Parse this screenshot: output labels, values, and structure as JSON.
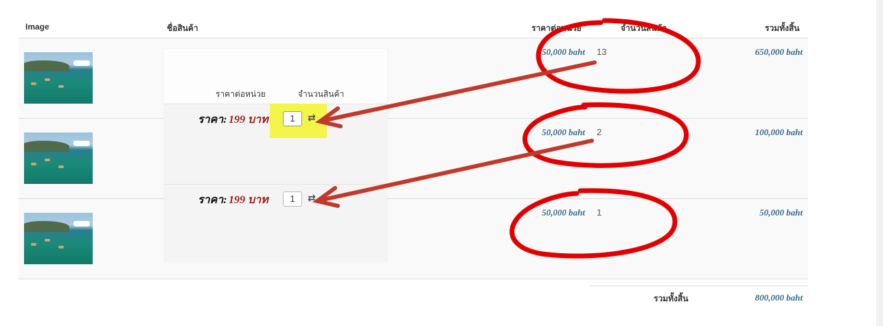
{
  "table": {
    "headers": {
      "image": "Image",
      "name": "ชื่อสินค้า",
      "unit_price": "ราคาต่อหน่วย",
      "quantity": "จำนวนสินค้า",
      "total": "รวมทั้งสิ้น"
    },
    "rows": [
      {
        "unit_price": "50,000 baht",
        "quantity": "13",
        "total": "650,000 baht"
      },
      {
        "unit_price": "50,000 baht",
        "quantity": "2",
        "total": "100,000 baht"
      },
      {
        "unit_price": "50,000 baht",
        "quantity": "1",
        "total": "50,000 baht"
      }
    ],
    "grand_total_label": "รวมทั้งสิ้น",
    "grand_total_value": "800,000 baht"
  },
  "overlay": {
    "headers": {
      "unit_price": "ราคาต่อหน่วย",
      "quantity": "จำนวนสินค้า"
    },
    "rows": [
      {
        "price_label": "ราคา:",
        "price_value": "199 บาท",
        "quantity": "1",
        "highlighted": true
      },
      {
        "price_label": "ราคา:",
        "price_value": "199 บาท",
        "quantity": "1",
        "highlighted": false
      }
    ]
  },
  "colors": {
    "accent_price": "#3a6d8c",
    "overlay_price": "#9b1b1b",
    "annotation_circle": "#e30000",
    "annotation_arrow": "#c0392b",
    "highlight": "#f4f44a"
  },
  "icons": [
    "refresh-icon"
  ]
}
